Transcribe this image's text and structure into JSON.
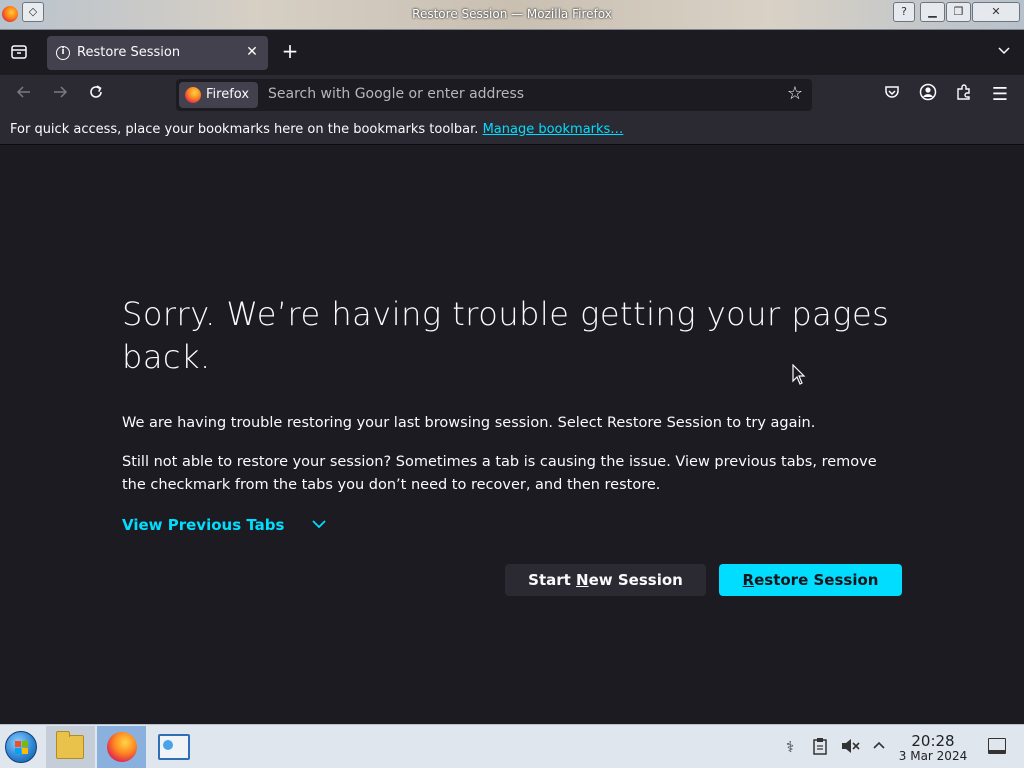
{
  "window": {
    "title": "Restore Session — Mozilla Firefox",
    "buttons": {
      "help": "?",
      "minimize": "▁",
      "maximize": "❐",
      "close": "✕"
    }
  },
  "tabs": {
    "items": [
      {
        "label": "Restore Session",
        "icon": "info-icon",
        "active": true
      }
    ]
  },
  "navbar": {
    "identity_label": "Firefox",
    "url_placeholder": "Search with Google or enter address",
    "url_value": ""
  },
  "bookmarks_bar": {
    "text": "For quick access, place your bookmarks here on the bookmarks toolbar.",
    "link": "Manage bookmarks…"
  },
  "content": {
    "heading": "Sorry. We’re having trouble getting your pages back.",
    "paragraph1": "We are having trouble restoring your last browsing session. Select Restore Session to try again.",
    "paragraph2": "Still not able to restore your session? Sometimes a tab is causing the issue. View previous tabs, remove the checkmark from the tabs you don’t need to recover, and then restore.",
    "view_previous_tabs": "View Previous Tabs",
    "start_new_session": {
      "before": "Start ",
      "mnemonic": "N",
      "after": "ew Session"
    },
    "restore_session": {
      "before": "",
      "mnemonic": "R",
      "after": "estore Session"
    }
  },
  "taskbar": {
    "clock_time": "20:28",
    "clock_date": "3 Mar 2024",
    "apps": [
      "file-manager",
      "firefox",
      "control-panel"
    ]
  },
  "colors": {
    "accent": "#00ddff",
    "page_bg": "#1c1b22",
    "toolbar_bg": "#2b2a33",
    "tab_active_bg": "#42414d",
    "text": "#fbfbfe"
  }
}
